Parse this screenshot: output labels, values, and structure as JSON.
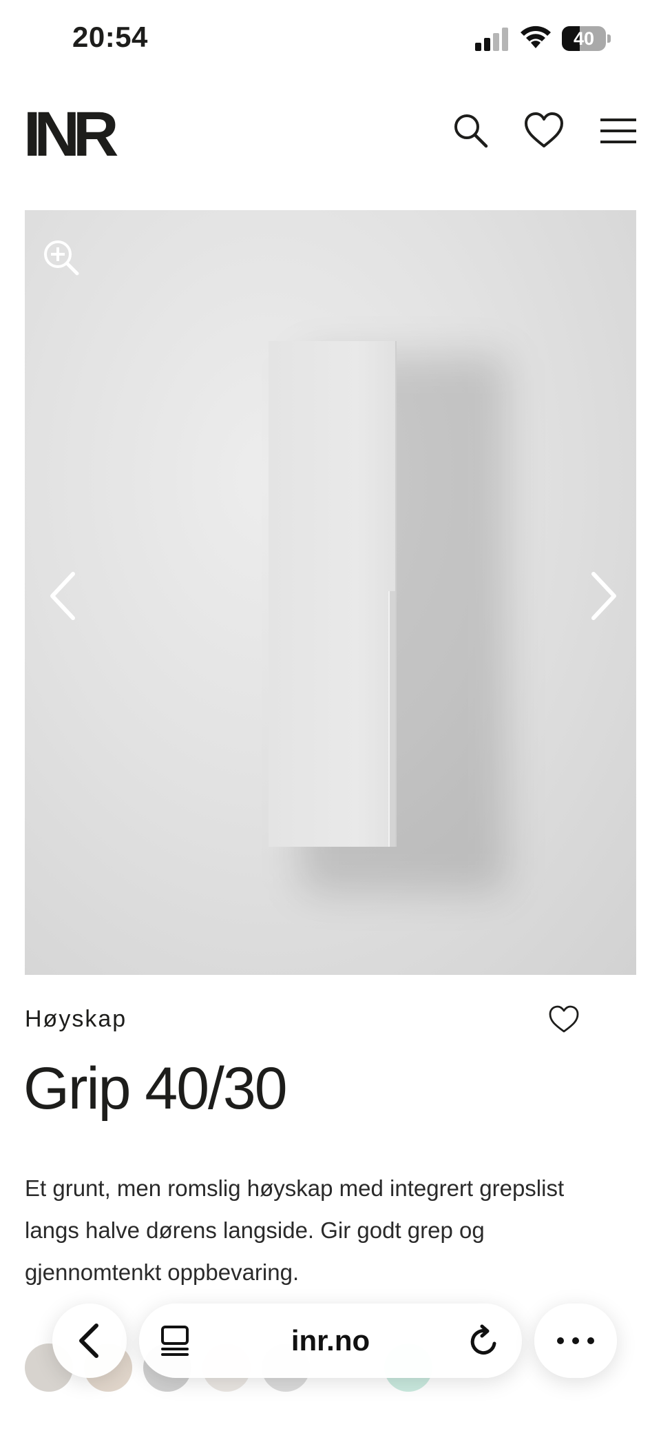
{
  "status_bar": {
    "time": "20:54",
    "battery": "40",
    "battery_level": 0.4,
    "icons": [
      "signal-icon",
      "wifi-icon",
      "battery-icon"
    ]
  },
  "header": {
    "logo": "INR",
    "icons": [
      "search-icon",
      "heart-icon",
      "menu-icon"
    ]
  },
  "gallery": {
    "icons": [
      "zoom-in-icon",
      "chevron-left-icon",
      "chevron-right-icon"
    ]
  },
  "product": {
    "category": "Høyskap",
    "title": "Grip 40/30",
    "description": "Et grunt, men romslig høyskap med integrert grepslist langs halve dørens langside. Gir godt grep og gjennomtenkt oppbevaring."
  },
  "swatches": [
    {
      "color": "#b7aea6"
    },
    {
      "color": "#c7b39f"
    },
    {
      "color": "#a8a8a8"
    },
    {
      "color": "#d8d2cb"
    },
    {
      "color": "#bdbdbd"
    },
    {
      "color": "#9fd8c4"
    }
  ],
  "browser": {
    "url": "inr.no",
    "icons": [
      "back-icon",
      "tabs-icon",
      "reload-icon",
      "more-icon"
    ]
  }
}
